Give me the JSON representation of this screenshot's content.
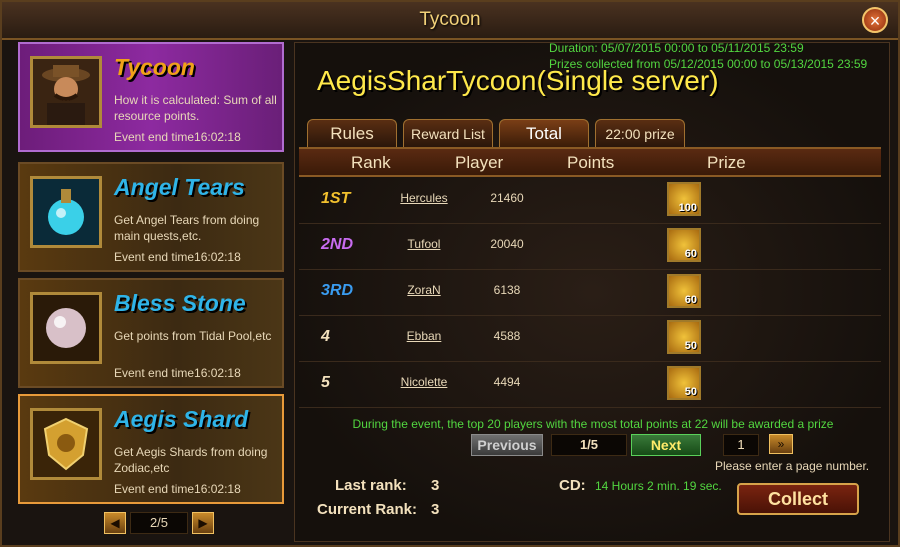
{
  "window": {
    "title": "Tycoon",
    "close_label": "×"
  },
  "events": [
    {
      "name": "Tycoon",
      "desc": "How it is calculated: Sum of all resource points.",
      "time": "Event end time16:02:18",
      "color": "#f0a218"
    },
    {
      "name": "Angel Tears",
      "desc": "Get Angel Tears from doing main quests,etc.",
      "time": "Event end time16:02:18",
      "color": "#2fb4e8"
    },
    {
      "name": "Bless Stone",
      "desc": "Get points from Tidal Pool,etc",
      "time": "Event end time16:02:18",
      "color": "#2fb4e8"
    },
    {
      "name": "Aegis Shard",
      "desc": "Get Aegis Shards from doing Zodiac,etc",
      "time": "Event end time16:02:18",
      "color": "#2fb4e8"
    }
  ],
  "left_pager": {
    "text": "2/5",
    "prev_icon": "◀",
    "next_icon": "▶"
  },
  "duration": "Duration: 05/07/2015 00:00 to 05/11/2015 23:59",
  "prize_period": "Prizes collected from 05/12/2015 00:00 to 05/13/2015 23:59",
  "event_title": "AegisSharTycoon(Single server)",
  "tabs": [
    "Rules",
    "Reward List",
    "Total",
    "22:00 prize"
  ],
  "headers": [
    "Rank",
    "Player",
    "Points",
    "Prize"
  ],
  "rows": [
    {
      "rank": "1ST",
      "player": "Hercules",
      "points": "21460",
      "prize": "100",
      "color": "#f2c12e"
    },
    {
      "rank": "2ND",
      "player": "Tufool",
      "points": "20040",
      "prize": "60",
      "color": "#c86cf0"
    },
    {
      "rank": "3RD",
      "player": "ZoraN",
      "points": "6138",
      "prize": "60",
      "color": "#3a9cf0"
    },
    {
      "rank": "4",
      "player": "Ebban",
      "points": "4588",
      "prize": "50",
      "color": "#f3e1bd"
    },
    {
      "rank": "5",
      "player": "Nicolette",
      "points": "4494",
      "prize": "50",
      "color": "#f3e1bd"
    }
  ],
  "award_note": "During the event, the top 20 players with the most total points at 22 will be awarded a prize",
  "pager": {
    "previous": "Previous",
    "page": "1/5",
    "next": "Next",
    "input": "1",
    "go": "»",
    "hint": "Please enter a page number."
  },
  "last_rank_label": "Last rank:",
  "last_rank": "3",
  "current_rank_label": "Current Rank:",
  "current_rank": "3",
  "cd_label": "CD:",
  "cd_value": "14 Hours 2 min. 19 sec.",
  "collect": "Collect"
}
